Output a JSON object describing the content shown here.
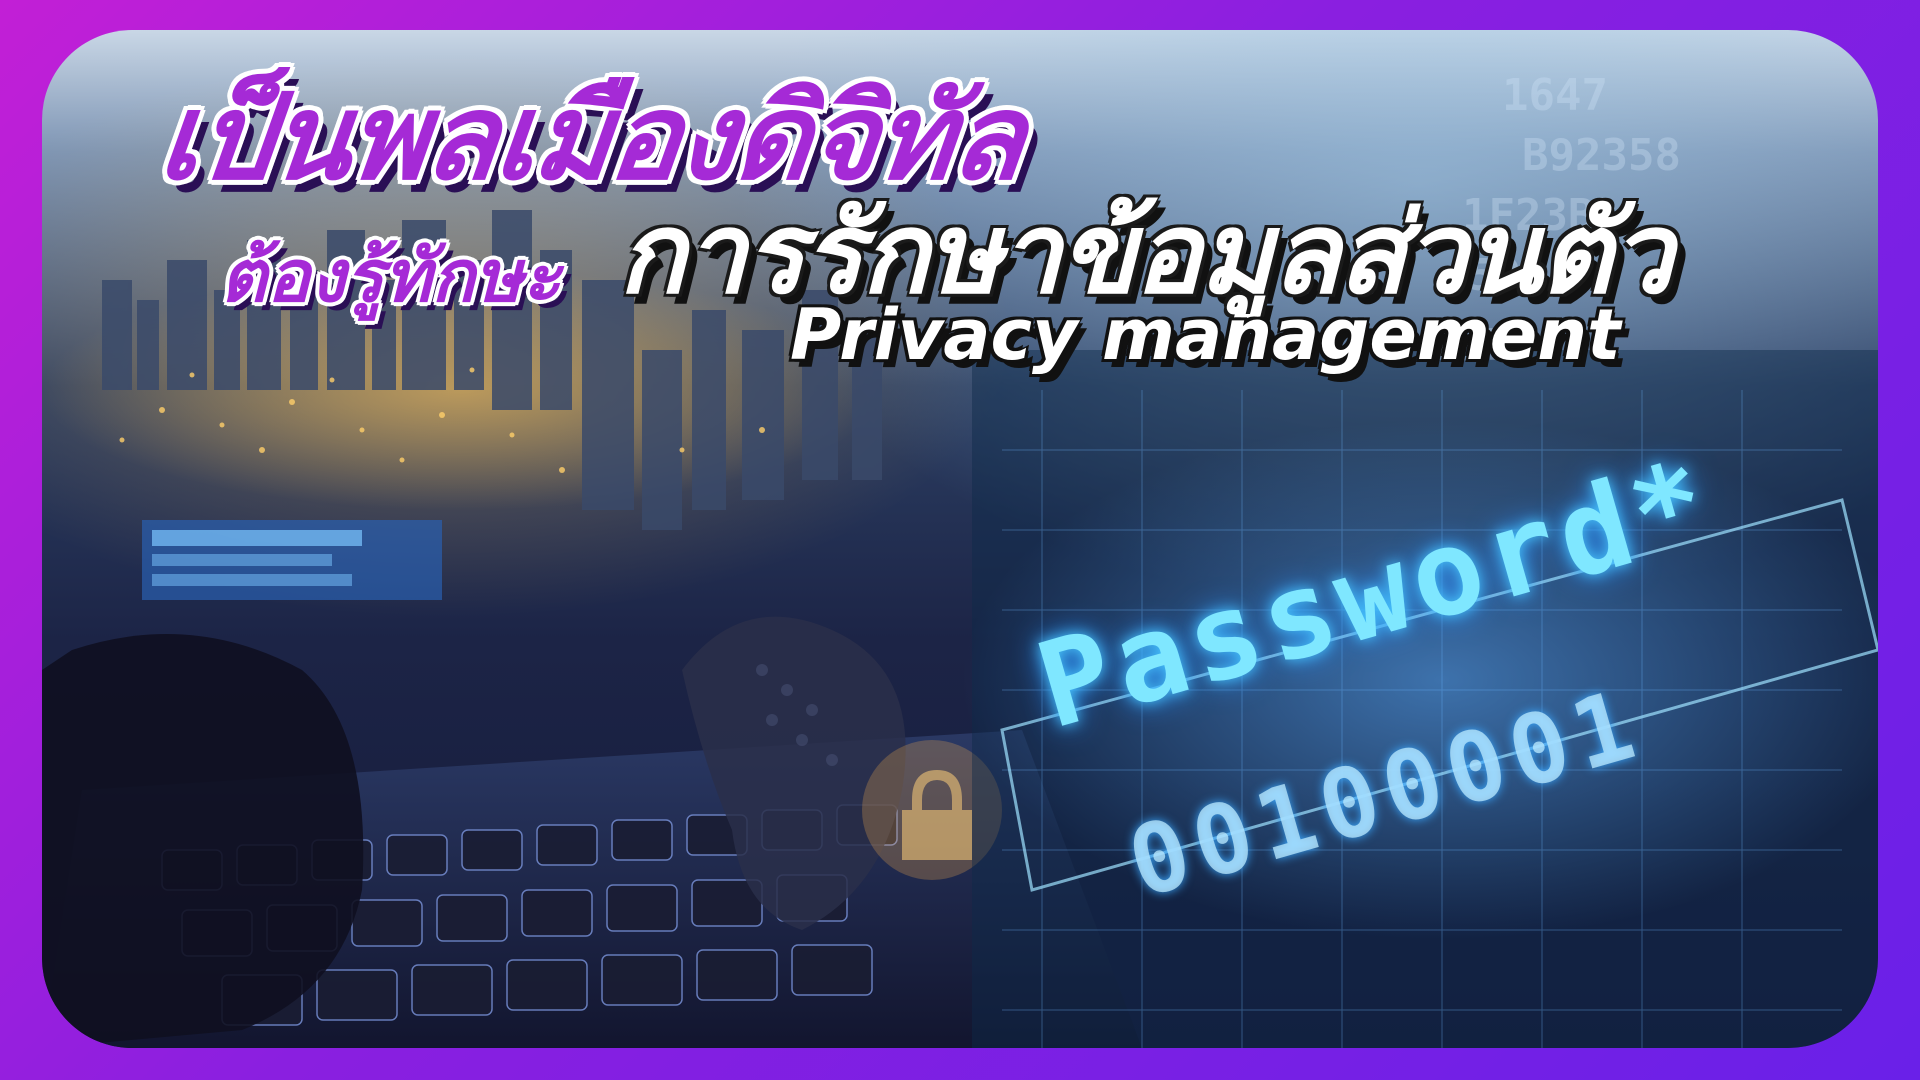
{
  "headline": {
    "line1": "เป็นพลเมืองดิจิทัล",
    "line2_prefix": "ต้องรู้ทักษะ",
    "line2_main": "การรักษาข้อมูลส่วนตัว",
    "line3": "Privacy management"
  },
  "scene": {
    "password_label": "Password*",
    "binary_text": "00100001"
  },
  "colors": {
    "background": "#8a1fe0",
    "accent_purple": "#a52ad6",
    "glow_cyan": "#7fe7ff"
  }
}
